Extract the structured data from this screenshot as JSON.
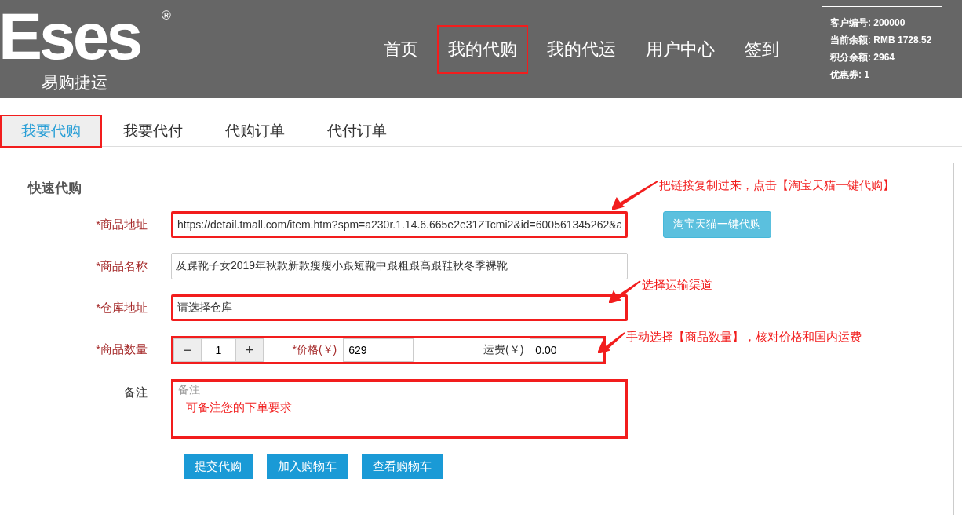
{
  "logo": {
    "wordmark": "Eses",
    "registered": "®",
    "subtitle": "易购捷运"
  },
  "nav": [
    {
      "label": "首页",
      "selected": false
    },
    {
      "label": "我的代购",
      "selected": true
    },
    {
      "label": "我的代运",
      "selected": false
    },
    {
      "label": "用户中心",
      "selected": false
    },
    {
      "label": "签到",
      "selected": false
    }
  ],
  "account": [
    {
      "label": "客户编号:",
      "value": "200000"
    },
    {
      "label": "当前余额:",
      "value": "RMB 1728.52"
    },
    {
      "label": "积分余额:",
      "value": "2964"
    },
    {
      "label": "优惠券:",
      "value": "1"
    }
  ],
  "tabs": [
    {
      "label": "我要代购",
      "selected": true
    },
    {
      "label": "我要代付",
      "selected": false
    },
    {
      "label": "代购订单",
      "selected": false
    },
    {
      "label": "代付订单",
      "selected": false
    }
  ],
  "form": {
    "title": "快速代购",
    "fields": [
      {
        "kind": "url",
        "label": "*商品地址",
        "required": true,
        "highlighted": true,
        "value": "https://detail.tmall.com/item.htm?spm=a230r.1.14.6.665e2e31ZTcmi2&id=600561345262&a",
        "button": "淘宝天猫一键代购",
        "annotation": "把链接复制过来，点击【淘宝天猫一键代购】"
      },
      {
        "kind": "text",
        "label": "*商品名称",
        "required": true,
        "highlighted": false,
        "value": "及踝靴子女2019年秋款新款瘦瘦小跟短靴中跟粗跟高跟鞋秋冬季裸靴"
      },
      {
        "kind": "select",
        "label": "*仓库地址",
        "required": true,
        "highlighted": true,
        "value": "请选择仓库",
        "annotation": "选择运输渠道"
      },
      {
        "kind": "quantity",
        "label": "*商品数量",
        "required": true,
        "highlighted": true,
        "minus": "−",
        "quantity": "1",
        "plus": "+",
        "price_label": "*价格(￥)",
        "price": "629",
        "freight_label": "运费(￥)",
        "freight": "0.00",
        "annotation": "手动选择【商品数量】，核对价格和国内运费"
      },
      {
        "kind": "textarea",
        "label": "备注",
        "required": false,
        "highlighted": true,
        "placeholder": "备注",
        "note": "可备注您的下单要求"
      }
    ]
  },
  "actions": [
    "提交代购",
    "加入购物车",
    "查看购物车"
  ]
}
